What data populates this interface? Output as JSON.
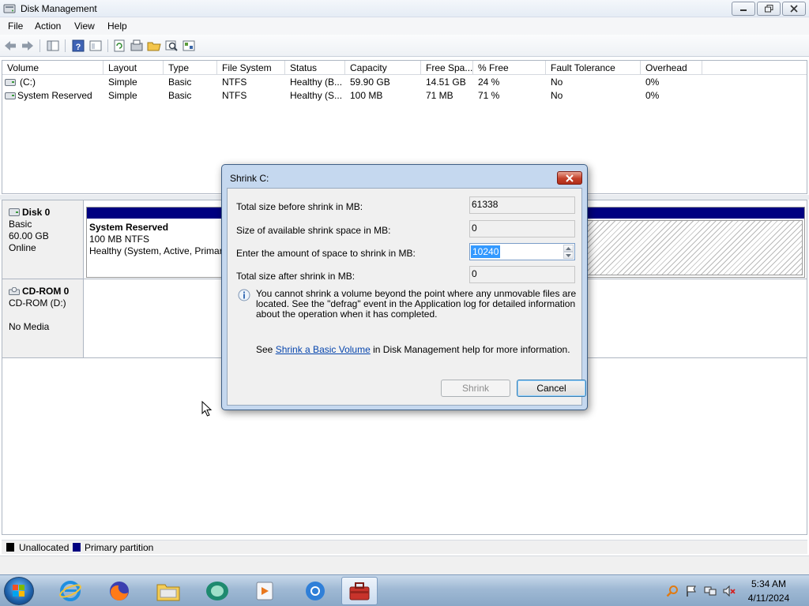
{
  "window": {
    "title": "Disk Management",
    "app_icon": "disk-management-icon"
  },
  "menu": [
    "File",
    "Action",
    "View",
    "Help"
  ],
  "toolbar_icons": [
    "back-arrow-icon",
    "forward-arrow-icon",
    "show-hide-tree-icon",
    "help-icon",
    "properties-icon",
    "refresh-icon",
    "rescan-disks-icon",
    "open-folder-icon",
    "explore-icon",
    "settings-icon"
  ],
  "volume_list": {
    "columns": [
      "Volume",
      "Layout",
      "Type",
      "File System",
      "Status",
      "Capacity",
      "Free Spa...",
      "% Free",
      "Fault Tolerance",
      "Overhead"
    ],
    "rows": [
      [
        "(C:)",
        "Simple",
        "Basic",
        "NTFS",
        "Healthy (B...",
        "59.90 GB",
        "14.51 GB",
        "24 %",
        "No",
        "0%"
      ],
      [
        "System Reserved",
        "Simple",
        "Basic",
        "NTFS",
        "Healthy (S...",
        "100 MB",
        "71 MB",
        "71 %",
        "No",
        "0%"
      ]
    ]
  },
  "disks": [
    {
      "name": "Disk 0",
      "type": "Basic",
      "size": "60.00 GB",
      "state": "Online",
      "partition": {
        "name": "System Reserved",
        "detail": "100 MB NTFS",
        "status": "Healthy (System, Active, Primar"
      }
    },
    {
      "name": "CD-ROM 0",
      "type": "CD-ROM (D:)",
      "state": "No Media"
    }
  ],
  "legend": [
    {
      "label": "Unallocated",
      "color": "#000000"
    },
    {
      "label": "Primary partition",
      "color": "#000080"
    }
  ],
  "dialog": {
    "title": "Shrink C:",
    "fields": [
      {
        "label": "Total size before shrink in MB:",
        "value": "61338"
      },
      {
        "label": "Size of available shrink space in MB:",
        "value": "0"
      },
      {
        "label": "Enter the amount of space to shrink in MB:",
        "value": "10240"
      },
      {
        "label": "Total size after shrink in MB:",
        "value": "0"
      }
    ],
    "info": "You cannot shrink a volume beyond the point where any unmovable files are located. See the \"defrag\" event in the Application log for detailed information about the operation when it has completed.",
    "help_prefix": "See",
    "help_link": "Shrink a Basic Volume",
    "help_suffix": "in Disk Management help for more information.",
    "shrink_label": "Shrink",
    "cancel_label": "Cancel"
  },
  "taskbar": {
    "apps": [
      "internet-explorer-icon",
      "firefox-icon",
      "file-explorer-icon",
      "app-icon",
      "media-player-icon",
      "chrome-icon",
      "toolbox-icon"
    ],
    "tray": [
      "search-icon",
      "flag-icon",
      "network-icon",
      "volume-muted-icon"
    ],
    "time": "5:34 AM",
    "date": "4/11/2024"
  }
}
